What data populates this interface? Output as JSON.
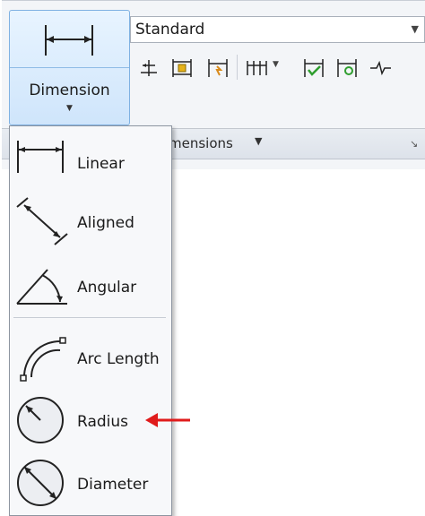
{
  "ribbon": {
    "dimension_button": {
      "label": "Dimension",
      "icon": "linear-dimension-icon"
    },
    "style_combo": {
      "value": "Standard"
    },
    "tools": [
      {
        "name": "baseline-icon"
      },
      {
        "name": "dimension-space-icon"
      },
      {
        "name": "dimension-break-icon"
      },
      {
        "name": "continue-icon",
        "has_dropdown": true
      },
      {
        "name": "inspect-icon"
      },
      {
        "name": "update-icon"
      },
      {
        "name": "jogged-linear-icon"
      }
    ],
    "panel_title": "Dimensions",
    "panel_title_visible": "mensions"
  },
  "menu": {
    "items": [
      {
        "label": "Linear",
        "icon": "linear-icon"
      },
      {
        "label": "Aligned",
        "icon": "aligned-icon"
      },
      {
        "label": "Angular",
        "icon": "angular-icon"
      },
      {
        "label": "Arc Length",
        "icon": "arc-length-icon"
      },
      {
        "label": "Radius",
        "icon": "radius-icon",
        "highlighted_by_arrow": true
      },
      {
        "label": "Diameter",
        "icon": "diameter-icon"
      }
    ]
  },
  "colors": {
    "ribbon_button_blue": "#cfe5fb",
    "annotation_arrow": "#e01b1b",
    "check_green": "#2f9e2f",
    "dim_orange": "#d98a1a"
  }
}
